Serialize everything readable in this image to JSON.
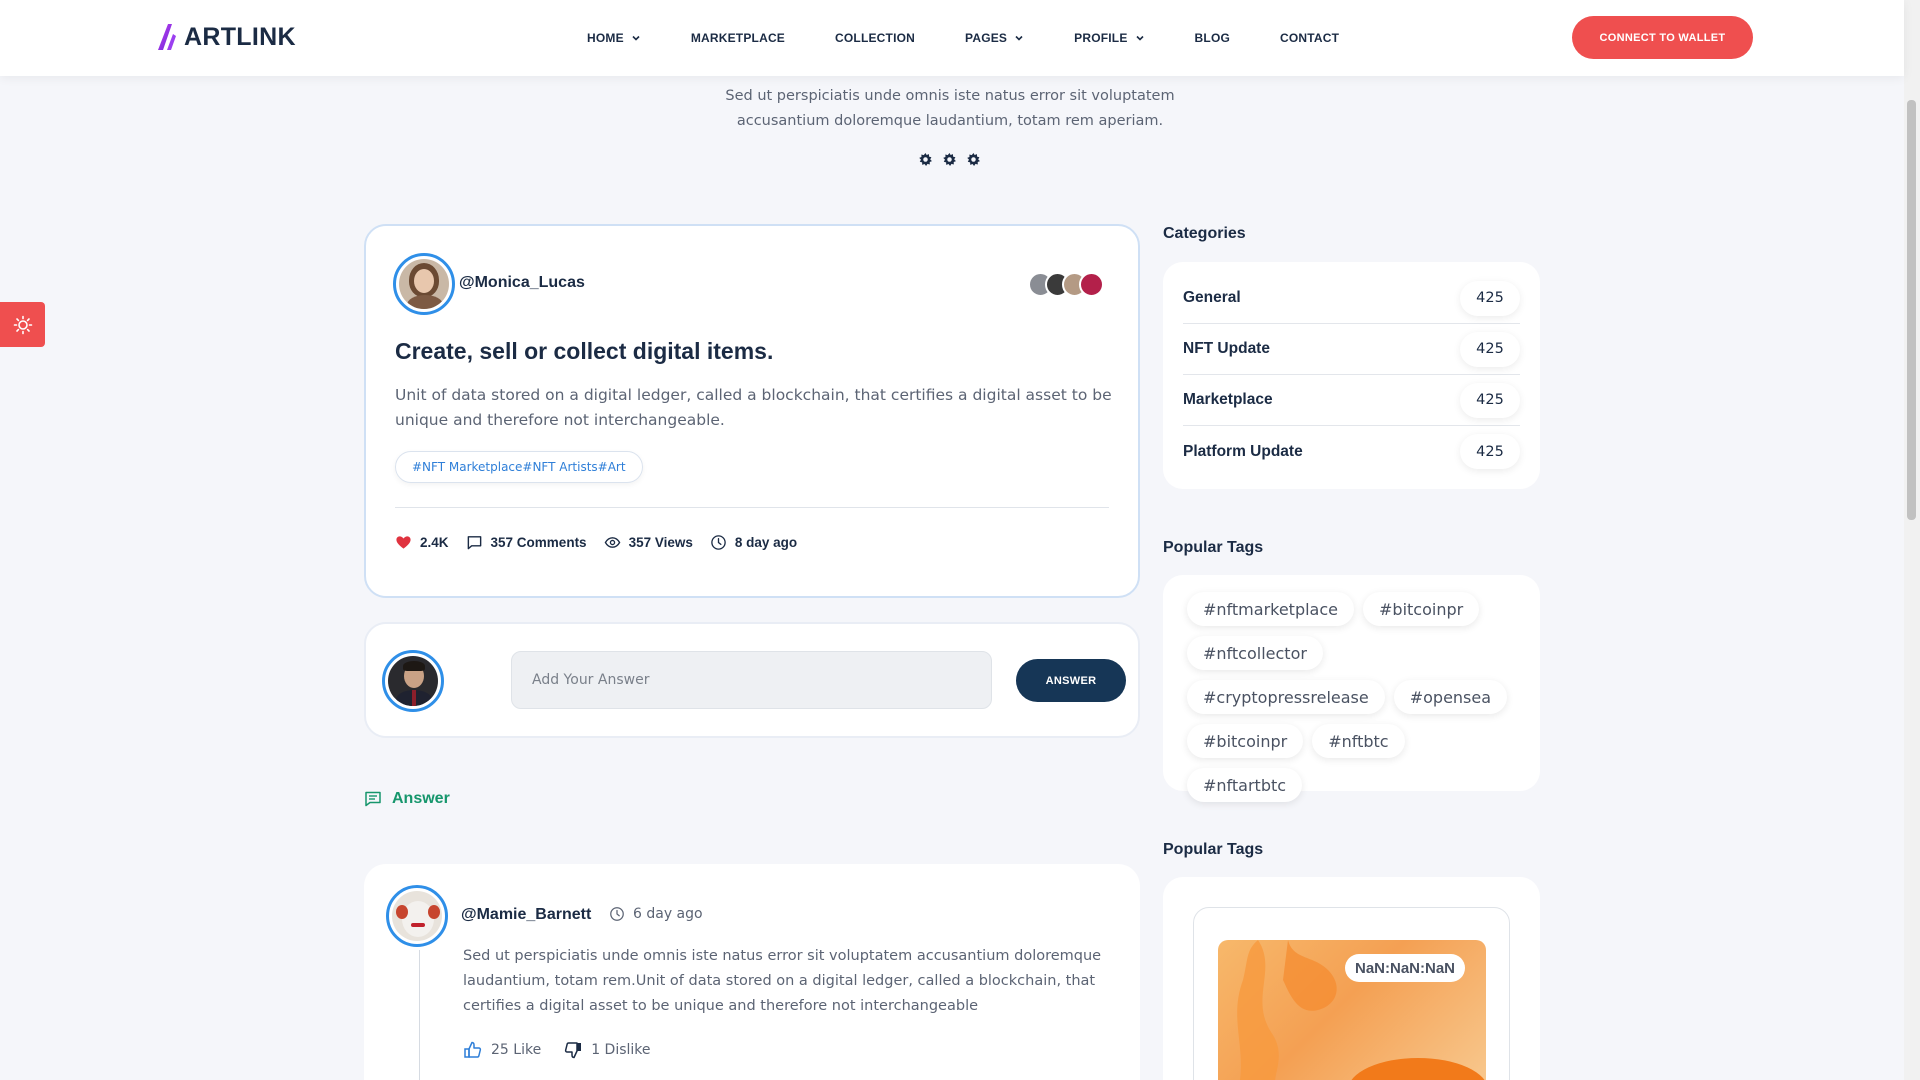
{
  "header": {
    "brand": "ARTLINK",
    "nav": [
      {
        "label": "HOME",
        "dropdown": true
      },
      {
        "label": "MARKETPLACE",
        "dropdown": false
      },
      {
        "label": "COLLECTION",
        "dropdown": false
      },
      {
        "label": "PAGES",
        "dropdown": true
      },
      {
        "label": "PROFILE",
        "dropdown": true
      },
      {
        "label": "BLOG",
        "dropdown": false
      },
      {
        "label": "CONTACT",
        "dropdown": false
      }
    ],
    "connect_label": "CONNECT TO WALLET"
  },
  "intro": {
    "text": "Sed ut perspiciatis unde omnis iste natus error sit voluptatem accusantium doloremque laudantium, totam rem aperiam."
  },
  "post": {
    "username": "@Monica_Lucas",
    "title": "Create, sell or collect digital items.",
    "description": "Unit of data stored on a digital ledger, called a blockchain, that certifies a digital asset to be unique and therefore not interchangeable.",
    "tags": "#NFT Marketplace#NFT Artists#Art",
    "likes": "2.4K",
    "comments": "357 Comments",
    "views": "357 Views",
    "time": "8 day ago"
  },
  "answer_form": {
    "placeholder": "Add Your Answer",
    "button_label": "ANSWER"
  },
  "answers_heading": "Answer",
  "reply": {
    "username": "@Mamie_Barnett",
    "time": "6 day ago",
    "text": "Sed ut perspiciatis unde omnis iste natus error sit voluptatem accusantium doloremque laudantium, totam rem.Unit of data stored on a digital ledger, called a blockchain, that certifies a digital asset to be unique and therefore not interchangeable",
    "likes": "25 Like",
    "dislikes": "1 Dislike"
  },
  "sidebar": {
    "categories_title": "Categories",
    "categories": [
      {
        "name": "General",
        "count": "425"
      },
      {
        "name": "NFT Update",
        "count": "425"
      },
      {
        "name": "Marketplace",
        "count": "425"
      },
      {
        "name": "Platform Update",
        "count": "425"
      }
    ],
    "popular_tags_title": "Popular Tags",
    "popular_tags": [
      "#nftmarketplace",
      "#bitcoinpr",
      "#nftcollector",
      "#cryptopressrelease",
      "#opensea",
      "#bitcoinpr",
      "#nftbtc",
      "#nftartbtc"
    ],
    "popular_tags_title_2": "Popular Tags",
    "nft_timer": "NaN:NaN:NaN"
  },
  "colors": {
    "accent_red": "#ef4f4f",
    "navy": "#163656",
    "answer_green": "#16966c",
    "link_blue": "#2f7fd8",
    "ring_blue": "#2f8fe8"
  }
}
